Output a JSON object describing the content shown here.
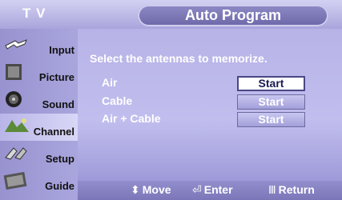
{
  "header": {
    "tv_label": "T V",
    "title": "Auto Program"
  },
  "sidebar": {
    "items": [
      {
        "label": "Input",
        "icon": "input-icon",
        "active": false
      },
      {
        "label": "Picture",
        "icon": "picture-icon",
        "active": false
      },
      {
        "label": "Sound",
        "icon": "sound-icon",
        "active": false
      },
      {
        "label": "Channel",
        "icon": "channel-icon",
        "active": true
      },
      {
        "label": "Setup",
        "icon": "setup-icon",
        "active": false
      },
      {
        "label": "Guide",
        "icon": "guide-icon",
        "active": false
      }
    ]
  },
  "main": {
    "prompt": "Select the antennas to memorize.",
    "options": [
      {
        "label": "Air",
        "button": "Start",
        "selected": true
      },
      {
        "label": "Cable",
        "button": "Start",
        "selected": false
      },
      {
        "label": "Air + Cable",
        "button": "Start",
        "selected": false
      }
    ]
  },
  "footer": {
    "move": {
      "glyph": "⬍",
      "label": "Move"
    },
    "enter": {
      "glyph": "⏎",
      "label": "Enter"
    },
    "return": {
      "glyph": "Ⅲ",
      "label": "Return"
    }
  },
  "colors": {
    "accent": "#6c68a8",
    "background": "#bcb9e8",
    "selected_button": "#ffffff"
  }
}
